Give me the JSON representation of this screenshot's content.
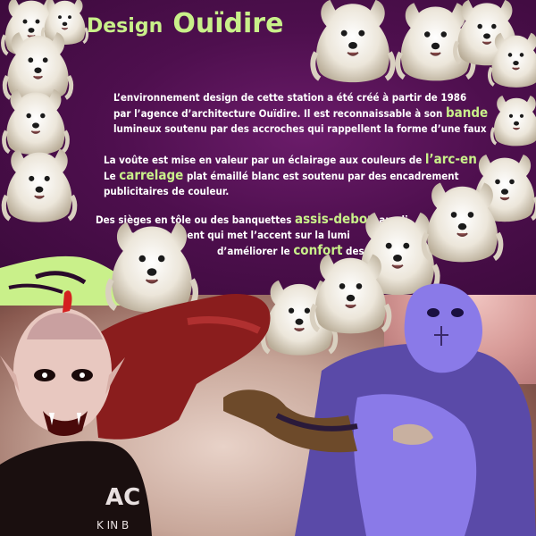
{
  "title": {
    "part1": "Design",
    "part2": "Ouïdire"
  },
  "paragraph1": {
    "line1": "L’environnement design de cette station a été créé à partir de 1986",
    "line2_a": "par l’agence d’architecture Ouïdire. Il est reconnaissable à son ",
    "line2_hl": "bande",
    "line3": "lumineux soutenu par des accroches qui rappellent la forme d’une faux"
  },
  "paragraph2": {
    "line1_a": "La voûte est mise en valeur par un éclairage aux couleurs de ",
    "line1_hl": "l’arc-en",
    "line2_a": "Le ",
    "line2_hl": "carrelage",
    "line2_b": " plat émaillé blanc est soutenu par des encadrement",
    "line3": "publicitaires de couleur."
  },
  "paragraph3": {
    "line1_a": "Des sièges en tôle ou des banquettes ",
    "line1_hl": "assis-debou",
    "line1_b": " ampli",
    "line2": "aménagement qui met l’accent sur la lumi",
    "line3_a": "d’améliorer le ",
    "line3_hl": "confort",
    "line3_b": " des"
  },
  "shirt_text": {
    "big": "AC",
    "small": "K IN B"
  },
  "colors": {
    "panel": "#4e0f4e",
    "accent_green": "#c9f08a",
    "figure_purple": "#8a7ae8"
  }
}
